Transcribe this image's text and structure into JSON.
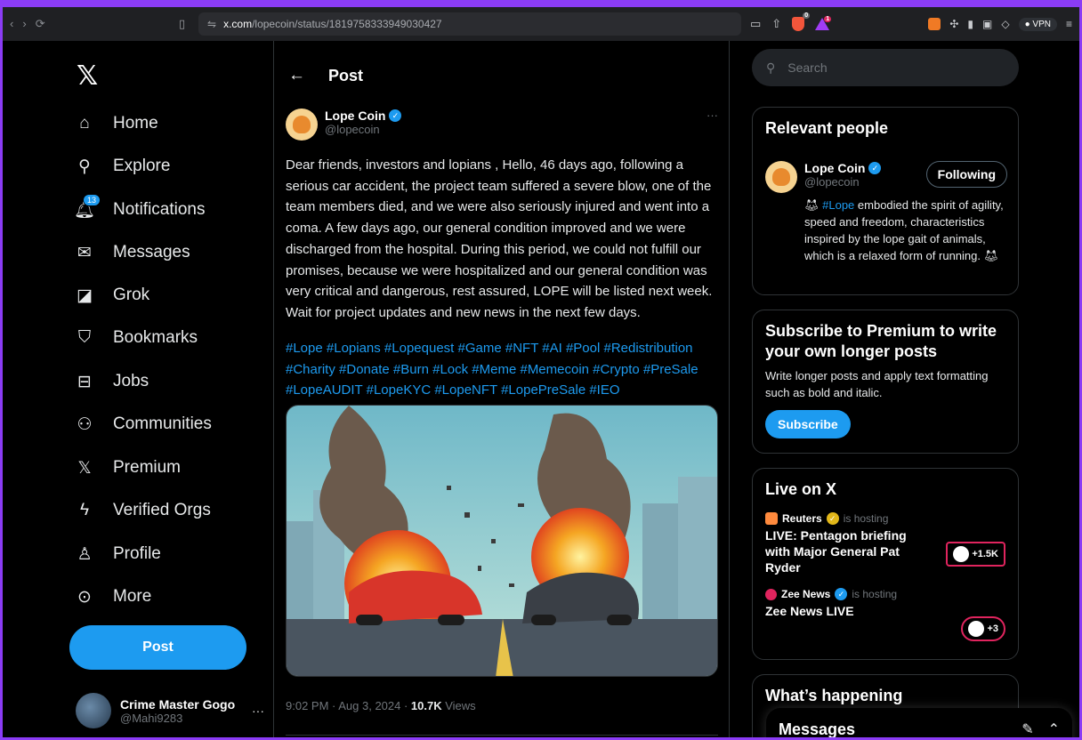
{
  "browser": {
    "url_host": "x.com",
    "url_path": "/lopecoin/status/1819758333949030427",
    "shield_count": "0",
    "alert_count": "1",
    "vpn_label": "VPN"
  },
  "nav": {
    "items": [
      {
        "label": "Home",
        "icon": "home-icon"
      },
      {
        "label": "Explore",
        "icon": "search-icon"
      },
      {
        "label": "Notifications",
        "icon": "bell-icon",
        "badge": "13"
      },
      {
        "label": "Messages",
        "icon": "envelope-icon"
      },
      {
        "label": "Grok",
        "icon": "grok-icon"
      },
      {
        "label": "Bookmarks",
        "icon": "bookmark-icon"
      },
      {
        "label": "Jobs",
        "icon": "briefcase-icon"
      },
      {
        "label": "Communities",
        "icon": "people-icon"
      },
      {
        "label": "Premium",
        "icon": "x-logo-icon"
      },
      {
        "label": "Verified Orgs",
        "icon": "lightning-icon"
      },
      {
        "label": "Profile",
        "icon": "person-icon"
      },
      {
        "label": "More",
        "icon": "more-circle-icon"
      }
    ],
    "post_button": "Post",
    "account": {
      "name": "Crime Master Gogo",
      "handle": "@Mahi9283"
    }
  },
  "post": {
    "header": "Post",
    "author_name": "Lope Coin",
    "author_handle": "@lopecoin",
    "text": "Dear friends, investors and lopians , Hello, 46 days ago, following a serious car accident, the project team suffered a severe blow, one of the team members died, and we were also seriously injured and went into a coma. A few days ago, our general condition improved and we were discharged from the hospital. During this period, we could not fulfill our promises, because we were hospitalized and our general condition was very critical and dangerous, rest assured, LOPE will be listed next week. Wait for project updates and new news in the next few days.",
    "hashtags": "#Lope #Lopians #Lopequest #Game #NFT #AI #Pool #Redistribution #Charity #Donate #Burn #Lock #Meme #Memecoin #Crypto #PreSale #LopeAUDIT #LopeKYC #LopeNFT #LopePreSale #IEO",
    "timestamp": "9:02 PM · Aug 3, 2024 · ",
    "views_count": "10.7K",
    "views_label": " Views"
  },
  "right": {
    "search_placeholder": "Search",
    "relevant": {
      "title": "Relevant people",
      "name": "Lope Coin",
      "handle": "@lopecoin",
      "follow_label": "Following",
      "bio_hashtag": "#Lope",
      "bio_text": " embodied the spirit of agility, speed and freedom, characteristics inspired by the lope gait of animals, which is a relaxed form of running. "
    },
    "premium": {
      "title": "Subscribe to Premium to write your own longer posts",
      "text": "Write longer posts and apply text formatting such as bold and italic.",
      "button": "Subscribe"
    },
    "live": {
      "title": "Live on X",
      "items": [
        {
          "host": "Reuters",
          "hosting": "is hosting",
          "title": "LIVE: Pentagon briefing with Major General Pat Ryder",
          "count": "+1.5K"
        },
        {
          "host": "Zee News",
          "hosting": "is hosting",
          "title": "Zee News LIVE",
          "count": "+3"
        }
      ]
    },
    "happening": {
      "title": "What’s happening"
    }
  },
  "messages_drawer": {
    "title": "Messages"
  },
  "colors": {
    "accent": "#1d9bf0",
    "frame": "#8b3cf5",
    "background": "#000000"
  }
}
